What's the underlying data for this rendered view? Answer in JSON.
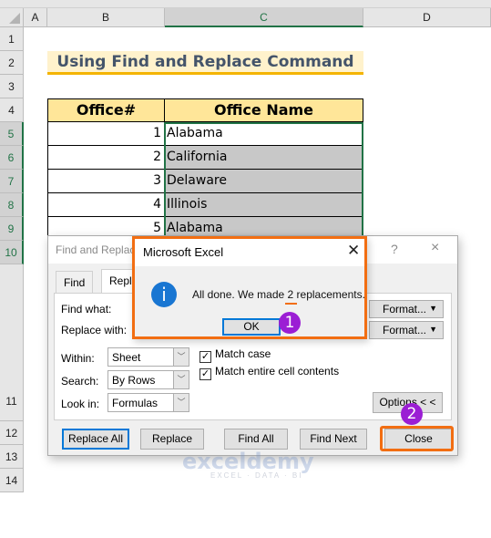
{
  "sheet": {
    "columns": [
      "A",
      "B",
      "C",
      "D"
    ],
    "selected_column": "C",
    "rows": [
      "1",
      "2",
      "3",
      "4",
      "5",
      "6",
      "7",
      "8",
      "9",
      "10",
      "11",
      "12",
      "13",
      "14"
    ],
    "title": "Using Find and Replace Command",
    "table": {
      "headers": [
        "Office#",
        "Office Name"
      ],
      "rows": [
        {
          "num": "1",
          "name": "Alabama"
        },
        {
          "num": "2",
          "name": "California"
        },
        {
          "num": "3",
          "name": "Delaware"
        },
        {
          "num": "4",
          "name": "Illinois"
        },
        {
          "num": "5",
          "name": "Alabama"
        }
      ]
    }
  },
  "find_replace": {
    "title": "Find and Replace",
    "help_icon": "?",
    "close_icon": "×",
    "tabs": [
      {
        "label": "Find",
        "active": false
      },
      {
        "label": "Replace",
        "active": true
      }
    ],
    "find_what_label": "Find what:",
    "replace_with_label": "Replace with:",
    "format_button_label": "Format...",
    "within_label": "Within:",
    "within_value": "Sheet",
    "search_label": "Search:",
    "search_value": "By Rows",
    "look_in_label": "Look in:",
    "look_in_value": "Formulas",
    "match_case_label": "Match case",
    "match_case_checked": true,
    "match_entire_label": "Match entire cell contents",
    "match_entire_checked": true,
    "options_label": "Options < <",
    "buttons": {
      "replace_all": "Replace All",
      "replace": "Replace",
      "find_all": "Find All",
      "find_next": "Find Next",
      "close": "Close"
    }
  },
  "message_box": {
    "title": "Microsoft Excel",
    "message_prefix": "All done. We made ",
    "message_count": "2",
    "message_suffix": " replacements.",
    "ok_label": "OK",
    "icon": "info-icon"
  },
  "annotations": {
    "step1": "1",
    "step2": "2",
    "highlight_color": "#f26e12",
    "badge_color": "#9b1ed4"
  },
  "watermark": {
    "brand": "exceldemy",
    "tagline": "EXCEL · DATA · BI"
  }
}
